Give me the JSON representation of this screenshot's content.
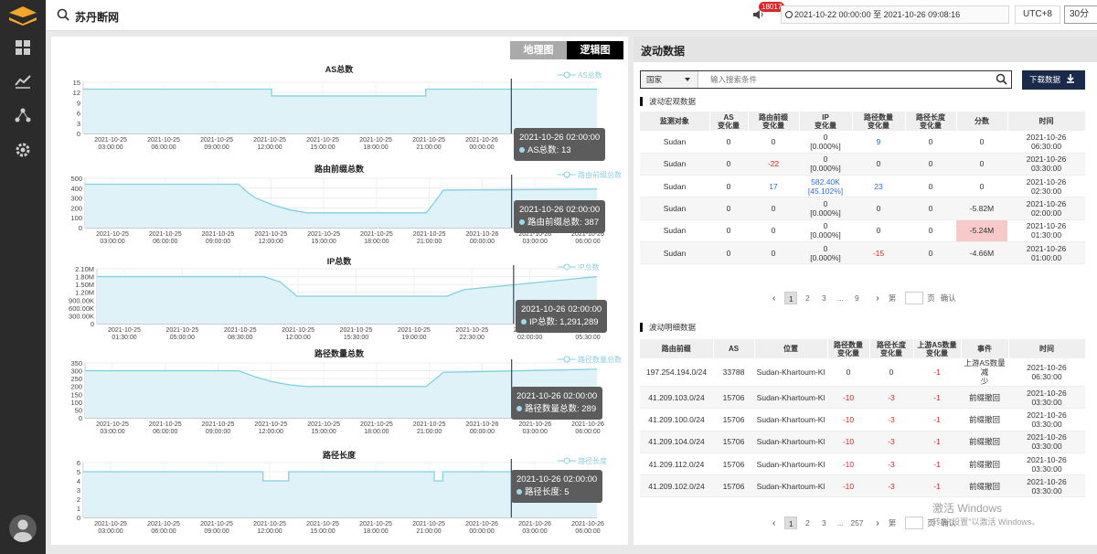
{
  "app": {
    "title": "苏丹断网"
  },
  "header": {
    "alert_count": "18017",
    "date_range": "2021-10-22 00:00:00 至 2021-10-26 09:08:16",
    "timezone": "UTC+8",
    "interval": "30分"
  },
  "left": {
    "toggle": {
      "geo": "地理图",
      "logic": "逻辑图"
    }
  },
  "charts": [
    {
      "title": "AS总数",
      "legend": "AS总数",
      "yticks": [
        "15",
        "12",
        "9",
        "6",
        "3",
        "0"
      ],
      "xticks": [
        "2021-10-25\n03:00:00",
        "2021-10-25\n06:00:00",
        "2021-10-25\n09:00:00",
        "2021-10-25\n12:00:00",
        "2021-10-25\n15:00:00",
        "2021-10-25\n18:00:00",
        "2021-10-25\n21:00:00",
        "2021-10-26\n00:00:00",
        "2021-10-26\n03:00:00",
        "2021-10-26\n06:00:00"
      ],
      "tooltip_time": "2021-10-26 02:00:00",
      "tooltip_label": "AS总数: 13"
    },
    {
      "title": "路由前缀总数",
      "legend": "路由前缀总数",
      "yticks": [
        "500",
        "400",
        "300",
        "200",
        "100",
        "0"
      ],
      "xticks": [
        "2021-10-25\n03:00:00",
        "2021-10-25\n06:00:00",
        "2021-10-25\n09:00:00",
        "2021-10-25\n12:00:00",
        "2021-10-25\n15:00:00",
        "2021-10-25\n18:00:00",
        "2021-10-25\n21:00:00",
        "2021-10-26\n00:00:00",
        "2021-10-26\n03:00:00",
        "2021-10-26\n06:00:00"
      ],
      "tooltip_time": "2021-10-26 02:00:00",
      "tooltip_label": "路由前缀总数: 387"
    },
    {
      "title": "IP总数",
      "legend": "IP总数",
      "yticks": [
        "2.10M",
        "1.80M",
        "1.50M",
        "1.20M",
        "900.00K",
        "600.00K",
        "300.00K",
        "0"
      ],
      "xticks": [
        "2021-10-25\n01:30:00",
        "2021-10-25\n05:00:00",
        "2021-10-25\n08:30:00",
        "2021-10-25\n12:00:00",
        "2021-10-25\n15:30:00",
        "2021-10-25\n19:00:00",
        "2021-10-25\n22:30:00",
        "2021-10-26\n02:00:00",
        "2021-10-26\n05:30:00"
      ],
      "tooltip_time": "2021-10-26 02:00:00",
      "tooltip_label": "IP总数: 1,291,289"
    },
    {
      "title": "路径数量总数",
      "legend": "路径数量总数",
      "yticks": [
        "350",
        "300",
        "250",
        "200",
        "150",
        "100",
        "50",
        "0"
      ],
      "xticks": [
        "2021-10-25\n03:00:00",
        "2021-10-25\n06:00:00",
        "2021-10-25\n09:00:00",
        "2021-10-25\n12:00:00",
        "2021-10-25\n15:00:00",
        "2021-10-25\n18:00:00",
        "2021-10-25\n21:00:00",
        "2021-10-26\n00:00:00",
        "2021-10-26\n03:00:00",
        "2021-10-26\n06:00:00"
      ],
      "tooltip_time": "2021-10-26 02:00:00",
      "tooltip_label": "路径数量总数: 289"
    },
    {
      "title": "路径长度",
      "legend": "路径长度",
      "yticks": [
        "6",
        "5",
        "4",
        "3",
        "2",
        "1",
        "0"
      ],
      "xticks": [
        "2021-10-25\n03:00:00",
        "2021-10-25\n06:00:00",
        "2021-10-25\n09:00:00",
        "2021-10-25\n12:00:00",
        "2021-10-25\n15:00:00",
        "2021-10-25\n18:00:00",
        "2021-10-25\n21:00:00",
        "2021-10-26\n00:00:00",
        "2021-10-26\n03:00:00",
        "2021-10-26\n06:00:00"
      ],
      "tooltip_time": "2021-10-26 02:00:00",
      "tooltip_label": "路径长度: 5"
    }
  ],
  "chart_data": [
    {
      "type": "area",
      "title": "AS总数",
      "ylim": [
        0,
        15
      ],
      "x": [
        "2021-10-25 01:00",
        "2021-10-25 12:00",
        "2021-10-25 21:00",
        "2021-10-26 02:00",
        "2021-10-26 07:00"
      ],
      "series": [
        {
          "name": "AS总数",
          "x": [
            "2021-10-25 01:00",
            "2021-10-25 12:00",
            "2021-10-25 12:00",
            "2021-10-25 21:00",
            "2021-10-25 21:00",
            "2021-10-26 07:00"
          ],
          "values": [
            13,
            13,
            11,
            11,
            13,
            13
          ]
        }
      ]
    },
    {
      "type": "area",
      "title": "路由前缀总数",
      "ylim": [
        0,
        500
      ],
      "series": [
        {
          "name": "路由前缀总数",
          "x": [
            "2021-10-25 01:00",
            "2021-10-25 10:00",
            "2021-10-25 10:30",
            "2021-10-25 11:00",
            "2021-10-25 12:00",
            "2021-10-25 13:00",
            "2021-10-25 14:00",
            "2021-10-25 21:00",
            "2021-10-25 21:30",
            "2021-10-25 22:00",
            "2021-10-26 07:00"
          ],
          "values": [
            440,
            440,
            360,
            300,
            230,
            180,
            150,
            150,
            260,
            380,
            390
          ]
        }
      ]
    },
    {
      "type": "area",
      "title": "IP总数",
      "ylim": [
        0,
        2100000
      ],
      "series": [
        {
          "name": "IP总数",
          "x": [
            "2021-10-25 01:00",
            "2021-10-25 11:00",
            "2021-10-25 12:00",
            "2021-10-25 13:00",
            "2021-10-25 22:00",
            "2021-10-25 23:00",
            "2021-10-26 07:00"
          ],
          "values": [
            1800000,
            1800000,
            1600000,
            1050000,
            1050000,
            1300000,
            1800000
          ]
        }
      ]
    },
    {
      "type": "area",
      "title": "路径数量总数",
      "ylim": [
        0,
        350
      ],
      "series": [
        {
          "name": "路径数量总数",
          "x": [
            "2021-10-25 01:00",
            "2021-10-25 10:00",
            "2021-10-25 11:00",
            "2021-10-25 12:00",
            "2021-10-25 13:00",
            "2021-10-25 14:00",
            "2021-10-25 21:00",
            "2021-10-25 22:00",
            "2021-10-26 07:00"
          ],
          "values": [
            300,
            300,
            260,
            230,
            210,
            200,
            200,
            290,
            310
          ]
        }
      ]
    },
    {
      "type": "area",
      "title": "路径长度",
      "ylim": [
        0,
        6
      ],
      "series": [
        {
          "name": "路径长度",
          "x": [
            "2021-10-25 01:00",
            "2021-10-25 11:30",
            "2021-10-25 11:30",
            "2021-10-25 13:00",
            "2021-10-25 13:00",
            "2021-10-25 21:30",
            "2021-10-25 21:30",
            "2021-10-25 22:00",
            "2021-10-25 22:00",
            "2021-10-26 07:00"
          ],
          "values": [
            5,
            5,
            4,
            4,
            5,
            5,
            4,
            4,
            5,
            5
          ]
        }
      ]
    }
  ],
  "right": {
    "title": "波动数据",
    "country_select": "国家",
    "search_placeholder": "输入搜索条件",
    "download": "下载数据",
    "macro_label": "波动宏观数据",
    "macro_headers": [
      "监测对象",
      "AS\n变化量",
      "路由前缀\n变化量",
      "IP\n变化量",
      "路径数量\n变化量",
      "路径长度\n变化量",
      "分数",
      "时间"
    ],
    "macro_rows": [
      [
        "Sudan",
        "0",
        "0",
        "0\n[0.000%]",
        "9",
        "0",
        "0",
        "2021-10-26\n06:30:00"
      ],
      [
        "Sudan",
        "0",
        "-22",
        "0\n[0.000%]",
        "0",
        "0",
        "0",
        "2021-10-26\n03:30:00"
      ],
      [
        "Sudan",
        "0",
        "17",
        "582.40K\n[45.102%]",
        "23",
        "0",
        "0",
        "2021-10-26\n02:30:00"
      ],
      [
        "Sudan",
        "0",
        "0",
        "0\n[0.000%]",
        "0",
        "0",
        "-5.82M",
        "2021-10-26\n02:00:00"
      ],
      [
        "Sudan",
        "0",
        "0",
        "0\n[0.000%]",
        "0",
        "0",
        "-5.24M",
        "2021-10-26\n01:30:00"
      ],
      [
        "Sudan",
        "0",
        "0",
        "0\n[0.000%]",
        "-15",
        "0",
        "-4.66M",
        "2021-10-26\n01:00:00"
      ]
    ],
    "pager1": {
      "pages": [
        "1",
        "2",
        "3",
        "...",
        "9"
      ],
      "goto": "第",
      "page": "页",
      "confirm": "确认"
    },
    "detail_label": "波动明细数据",
    "detail_headers": [
      "路由前缀",
      "AS",
      "位置",
      "路径数量\n变化量",
      "路径长度\n变化量",
      "上游AS数量\n变化量",
      "事件",
      "时间"
    ],
    "detail_rows": [
      [
        "197.254.194.0/24",
        "33788",
        "Sudan-Khartoum-Kl",
        "0",
        "0",
        "-1",
        "上游AS数量减\n少",
        "2021-10-26\n06:30:00"
      ],
      [
        "41.209.103.0/24",
        "15706",
        "Sudan-Khartoum-Kl",
        "-10",
        "-3",
        "-1",
        "前缀撤回",
        "2021-10-26\n03:30:00"
      ],
      [
        "41.209.100.0/24",
        "15706",
        "Sudan-Khartoum-Kl",
        "-10",
        "-3",
        "-1",
        "前缀撤回",
        "2021-10-26\n03:30:00"
      ],
      [
        "41.209.104.0/24",
        "15706",
        "Sudan-Khartoum-Kl",
        "-10",
        "-3",
        "-1",
        "前缀撤回",
        "2021-10-26\n03:30:00"
      ],
      [
        "41.209.112.0/24",
        "15706",
        "Sudan-Khartoum-Kl",
        "-10",
        "-3",
        "-1",
        "前缀撤回",
        "2021-10-26\n03:30:00"
      ],
      [
        "41.209.102.0/24",
        "15706",
        "Sudan-Khartoum-Kl",
        "-10",
        "-3",
        "-1",
        "前缀撤回",
        "2021-10-26\n03:30:00"
      ]
    ],
    "pager2": {
      "pages": [
        "1",
        "2",
        "3",
        "...",
        "257"
      ],
      "goto": "第",
      "page": "页",
      "confirm": "确认"
    },
    "watermark": "激活 Windows",
    "watermark_sub": "转到\"设置\"以激活 Windows。"
  },
  "colors": {
    "line": "#7fd1e3",
    "fill": "#dff2f8",
    "tooltip": "#5c5c5c",
    "accent": "#1b2a4a",
    "negative": "#e02424",
    "positive": "#2b6fd6"
  }
}
